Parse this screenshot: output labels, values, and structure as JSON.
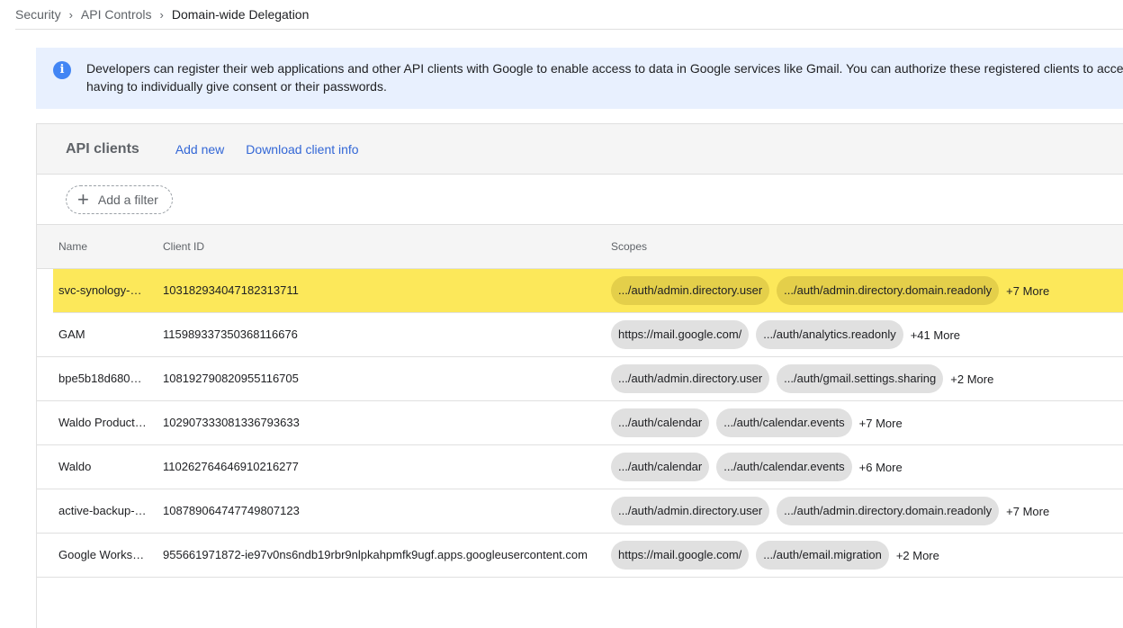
{
  "breadcrumb": {
    "items": [
      "Security",
      "API Controls"
    ],
    "current": "Domain-wide Delegation"
  },
  "banner": {
    "icon": "info-icon",
    "text": "Developers can register their web applications and other API clients with Google to enable access to data in Google services like Gmail. You can authorize these registered clients to access your user data without your users having to individually give consent or their passwords."
  },
  "panel": {
    "title": "API clients",
    "add_new": "Add new",
    "download": "Download client info",
    "filter": "Add a filter"
  },
  "table": {
    "headers": {
      "name": "Name",
      "client_id": "Client ID",
      "scopes": "Scopes"
    },
    "rows": [
      {
        "name": "svc-synology-b…",
        "client_id": "103182934047182313711",
        "scopes": [
          ".../auth/admin.directory.user",
          ".../auth/admin.directory.domain.readonly"
        ],
        "more": "+7 More",
        "selected": true
      },
      {
        "name": "GAM",
        "client_id": "115989337350368116676",
        "scopes": [
          "https://mail.google.com/",
          ".../auth/analytics.readonly"
        ],
        "more": "+41 More"
      },
      {
        "name": "bpe5b18d6807…",
        "client_id": "108192790820955116705",
        "scopes": [
          ".../auth/admin.directory.user",
          ".../auth/gmail.settings.sharing"
        ],
        "more": "+2 More"
      },
      {
        "name": "Waldo Product…",
        "client_id": "102907333081336793633",
        "scopes": [
          ".../auth/calendar",
          ".../auth/calendar.events"
        ],
        "more": "+7 More"
      },
      {
        "name": "Waldo",
        "client_id": "110262764646910216277",
        "scopes": [
          ".../auth/calendar",
          ".../auth/calendar.events"
        ],
        "more": "+6 More"
      },
      {
        "name": "active-backup-…",
        "client_id": "108789064747749807123",
        "scopes": [
          ".../auth/admin.directory.user",
          ".../auth/admin.directory.domain.readonly"
        ],
        "more": "+7 More"
      },
      {
        "name": "Google Works…",
        "client_id": "955661971872-ie97v0ns6ndb19rbr9nlpkahpmfk9ugf.apps.googleusercontent.com",
        "scopes": [
          "https://mail.google.com/",
          ".../auth/email.migration"
        ],
        "more": "+2 More"
      }
    ]
  },
  "colors": {
    "accent": "#3367d6",
    "selected_row": "#fce85a",
    "banner_bg": "#e8f0fe",
    "info": "#4285f4"
  }
}
